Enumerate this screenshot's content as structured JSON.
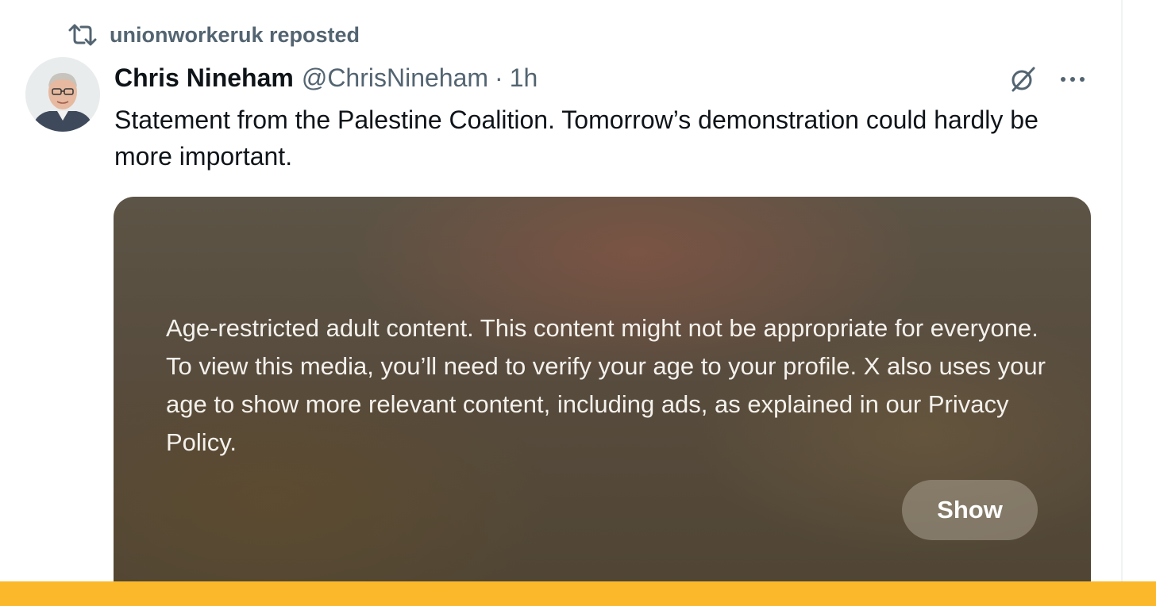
{
  "repost": {
    "icon": "repost-icon",
    "text": "unionworkeruk reposted"
  },
  "tweet": {
    "avatar": "avatar-image",
    "author_name": "Chris Nineham",
    "author_handle": "@ChrisNineham",
    "separator": "·",
    "time": "1h",
    "text": "Statement from the Palestine Coalition. Tomorrow’s demonstration could hardly be more important.",
    "actions": {
      "grok_icon": "grok-icon",
      "more_icon": "more-options-icon"
    }
  },
  "media": {
    "warning": "Age-restricted adult content. This content might not be appropriate for everyone. To view this media, you’ll need to verify your age to your profile. X also uses your age to show more relevant content, including ads, as explained in our Privacy Policy.",
    "show_label": "Show"
  },
  "colors": {
    "text_primary": "#0f1419",
    "text_secondary": "#536471",
    "footer_bar": "#fbb82a",
    "media_overlay": "#574b3d"
  }
}
